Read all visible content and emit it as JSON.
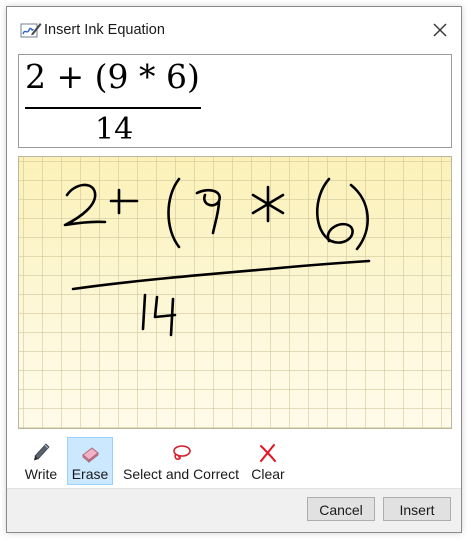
{
  "window": {
    "title": "Insert Ink Equation",
    "title_icon": "ink-equation-icon",
    "close_icon": "close-icon"
  },
  "preview": {
    "numerator": "2 + (9 * 6)",
    "denominator": "14"
  },
  "ink_pad": {
    "handwriting": "2 + (9 * 6) / 14",
    "background": "#fdf7d2"
  },
  "toolbar": {
    "write": {
      "label": "Write",
      "icon": "pen-icon"
    },
    "erase": {
      "label": "Erase",
      "icon": "eraser-icon",
      "active": true
    },
    "select_correct": {
      "label": "Select and Correct",
      "icon": "lasso-icon"
    },
    "clear": {
      "label": "Clear",
      "icon": "clear-x-icon"
    }
  },
  "footer": {
    "cancel_label": "Cancel",
    "insert_label": "Insert"
  },
  "colors": {
    "selected_tool_bg": "#cce8ff",
    "selected_tool_border": "#99d1ff",
    "clear_icon": "#e81123"
  }
}
